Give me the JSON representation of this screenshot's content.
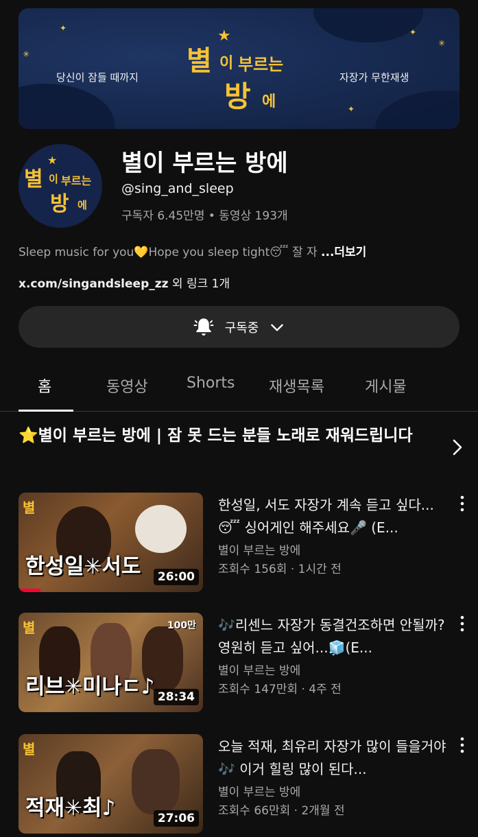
{
  "banner": {
    "left_text": "당신이 잠들 때까지",
    "right_text": "자장가 무한재생",
    "logo": [
      "별",
      "이",
      "부르는",
      "방",
      "에"
    ]
  },
  "channel": {
    "name": "별이 부르는 방에",
    "handle": "@sing_and_sleep",
    "stats": "구독자 6.45만명 • 동영상 193개",
    "description": "Sleep music for you💛Hope you sleep tight😴 잘 자 ",
    "more": "...더보기",
    "link": "x.com/singandsleep_zz",
    "link_suffix": " 외 링크 1개"
  },
  "subscribe": {
    "label": "구독중",
    "bell_icon": "bell-icon",
    "dropdown_icon": "chevron-down-icon"
  },
  "tabs": [
    {
      "label": "홈",
      "active": true
    },
    {
      "label": "동영상",
      "active": false
    },
    {
      "label": "Shorts",
      "active": false
    },
    {
      "label": "재생목록",
      "active": false
    },
    {
      "label": "게시물",
      "active": false
    }
  ],
  "section": {
    "title": "⭐별이 부르는 방에 | 잠 못 드는  분들 노래로 재워드립니다"
  },
  "videos": [
    {
      "title": "한성일, 서도 자장가 계속 듣고 싶다...😴 싱어게인 해주세요🎤 (E...",
      "channel": "별이 부르는 방에",
      "meta": "조회수 156회 · 1시간 전",
      "duration": "26:00",
      "thumb_text": "한성일✳서도",
      "badge": "",
      "watched_fraction": 0.12
    },
    {
      "title": "🎶리센느 자장가 동결건조하면 안될까? 영원히 듣고 싶어...🧊(E...",
      "channel": "별이 부르는 방에",
      "meta": "조회수 147만회 · 4주 전",
      "duration": "28:34",
      "thumb_text": "리브✳미나ㄷ♪",
      "badge": "100만",
      "watched_fraction": 0
    },
    {
      "title": "오늘 적재, 최유리 자장가 많이 들을거야🎶 이거 힐링 많이 된다...",
      "channel": "별이 부르는 방에",
      "meta": "조회수 66만회 · 2개월 전",
      "duration": "27:06",
      "thumb_text": "적재✳최♪",
      "badge": "",
      "watched_fraction": 0
    }
  ],
  "colors": {
    "background": "#0f0f0f",
    "accent_yellow": "#f7c234",
    "banner_blue": "#1a2d57",
    "progress_red": "#ff0033"
  }
}
